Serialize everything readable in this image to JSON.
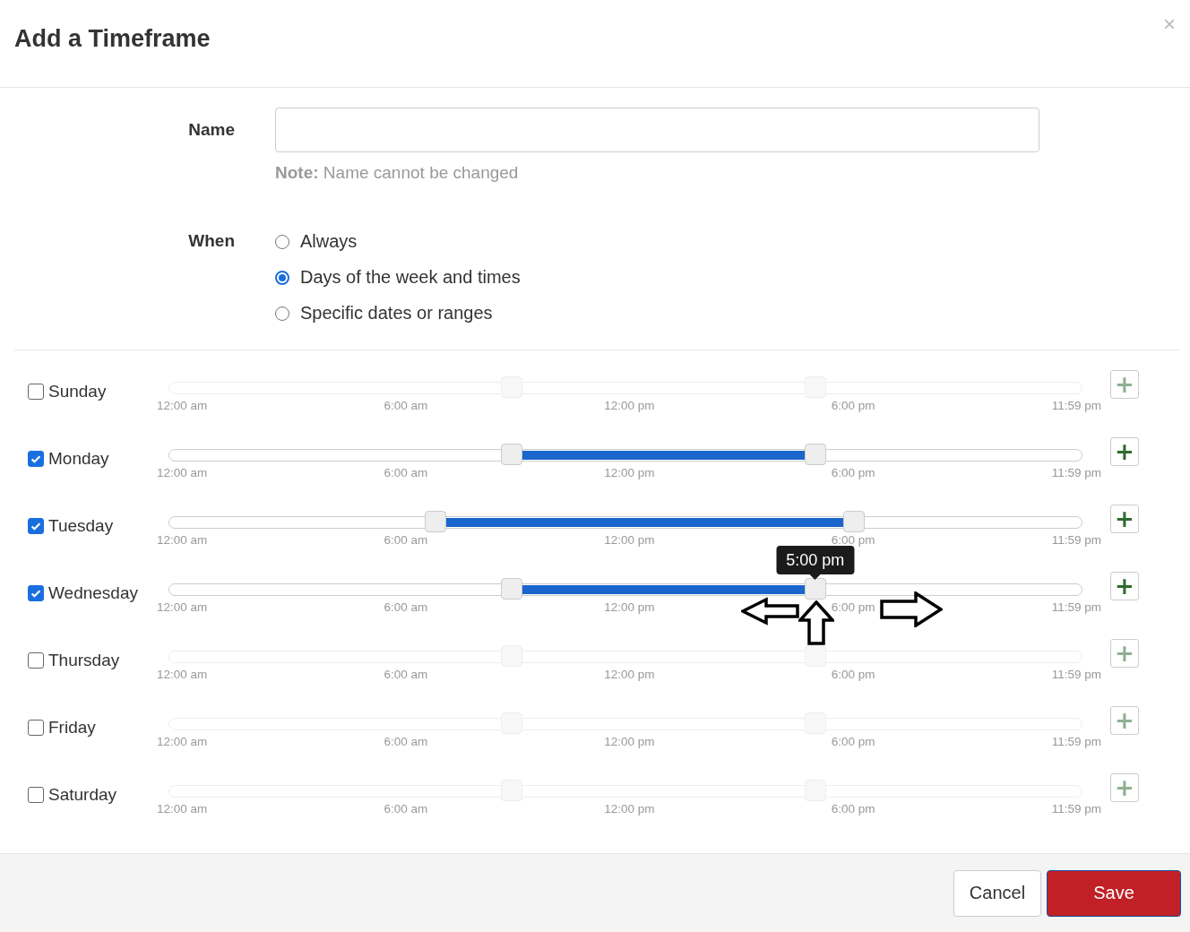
{
  "dialog": {
    "title": "Add a Timeframe",
    "close": "×"
  },
  "name_field": {
    "label": "Name",
    "note_label": "Note:",
    "note": "Name cannot be changed"
  },
  "when": {
    "label": "When",
    "options": [
      {
        "label": "Always",
        "selected": false
      },
      {
        "label": "Days of the week and times",
        "selected": true
      },
      {
        "label": "Specific dates or ranges",
        "selected": false
      }
    ]
  },
  "days": [
    {
      "name": "Sunday",
      "checked": false,
      "handles": [
        {
          "level": 0.375
        },
        {
          "level": 0.708
        }
      ],
      "ticks": [
        "12:00 am",
        "6:00 am",
        "12:00 pm",
        "6:00 pm",
        "11:59 pm"
      ],
      "add": "+"
    },
    {
      "name": "Monday",
      "checked": true,
      "handles": [
        {
          "level": 0.375
        },
        {
          "level": 0.708
        }
      ],
      "ticks": [
        "12:00 am",
        "6:00 am",
        "12:00 pm",
        "6:00 pm",
        "11:59 pm"
      ],
      "add": "+"
    },
    {
      "name": "Tuesday",
      "checked": true,
      "handles": [
        {
          "level": 0.292
        },
        {
          "level": 0.75
        }
      ],
      "ticks": [
        "12:00 am",
        "6:00 am",
        "12:00 pm",
        "6:00 pm",
        "11:59 pm"
      ],
      "add": "+"
    },
    {
      "name": "Wednesday",
      "checked": true,
      "handles": [
        {
          "level": 0.375
        },
        {
          "level": 0.708
        }
      ],
      "ticks": [
        "12:00 am",
        "6:00 am",
        "12:00 pm",
        "6:00 pm",
        "11:59 pm"
      ],
      "tooltip": "5:00 pm",
      "add": "+"
    },
    {
      "name": "Thursday",
      "checked": false,
      "handles": [
        {
          "level": 0.375
        },
        {
          "level": 0.708
        }
      ],
      "ticks": [
        "12:00 am",
        "6:00 am",
        "12:00 pm",
        "6:00 pm",
        "11:59 pm"
      ],
      "add": "+"
    },
    {
      "name": "Friday",
      "checked": false,
      "handles": [
        {
          "level": 0.375
        },
        {
          "level": 0.708
        }
      ],
      "ticks": [
        "12:00 am",
        "6:00 am",
        "12:00 pm",
        "6:00 pm",
        "11:59 pm"
      ],
      "add": "+"
    },
    {
      "name": "Saturday",
      "checked": false,
      "handles": [
        {
          "level": 0.375
        },
        {
          "level": 0.708
        }
      ],
      "ticks": [
        "12:00 am",
        "6:00 am",
        "12:00 pm",
        "6:00 pm",
        "11:59 pm"
      ],
      "add": "+"
    }
  ],
  "buttons": [
    {
      "label": "Cancel",
      "kind": "secondary"
    },
    {
      "label": "Save",
      "kind": "primary"
    }
  ]
}
